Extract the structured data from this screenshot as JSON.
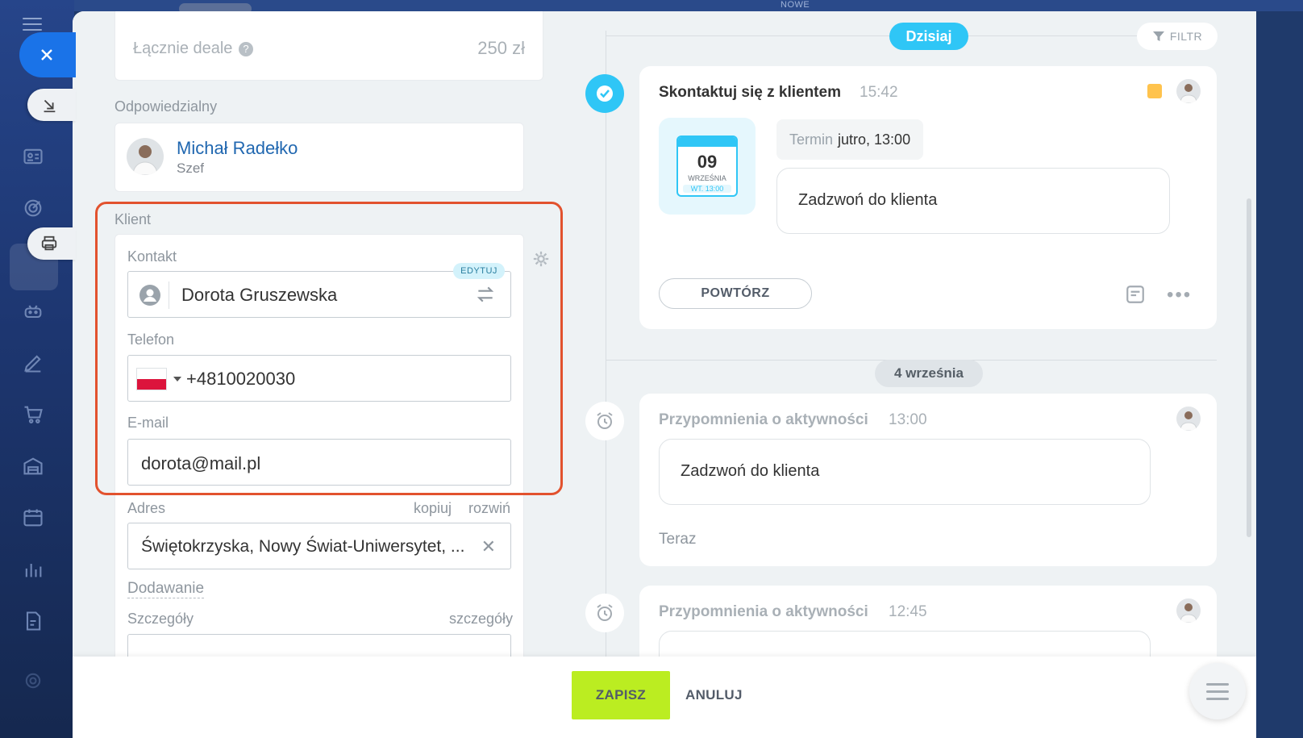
{
  "topbar": {
    "nowe_label": "NOWE"
  },
  "deals": {
    "label": "Łącznie deale",
    "value": "250 zł"
  },
  "responsible": {
    "section_label": "Odpowiedzialny",
    "name": "Michał Radełko",
    "role": "Szef"
  },
  "client": {
    "section_label": "Klient",
    "contact_label": "Kontakt",
    "edit_badge": "EDYTUJ",
    "contact_name": "Dorota Gruszewska",
    "phone_label": "Telefon",
    "phone_value": "+4810020030",
    "email_label": "E-mail",
    "email_value": "dorota@mail.pl"
  },
  "address": {
    "label": "Adres",
    "copy_link": "kopiuj",
    "expand_link": "rozwiń",
    "value": "Świętokrzyska, Nowy Świat-Uniwersytet, ..."
  },
  "adding_link": "Dodawanie",
  "details": {
    "label": "Szczegóły",
    "link": "szczegóły"
  },
  "timeline": {
    "today_badge": "Dzisiaj",
    "filter_label": "FILTR",
    "activity": {
      "title": "Skontaktuj się z klientem",
      "time": "15:42",
      "calendar_day": "09",
      "calendar_month": "WRZEŚNIA",
      "calendar_sub": "WT. 13:00",
      "deadline_label": "Termin",
      "deadline_value": "jutro, 13:00",
      "description": "Zadzwoń do klienta",
      "repeat_button": "POWTÓRZ"
    },
    "date_separator": "4 września",
    "reminders": [
      {
        "title": "Przypomnienia o aktywności",
        "time": "13:00",
        "text": "Zadzwoń do klienta",
        "footer": "Teraz"
      },
      {
        "title": "Przypomnienia o aktywności",
        "time": "12:45"
      }
    ]
  },
  "footer": {
    "save": "ZAPISZ",
    "cancel": "ANULUJ"
  },
  "colors": {
    "accent_blue": "#2fc6f6",
    "save_green": "#bbed21",
    "highlight_red": "#e2522e",
    "link_blue": "#2067b0",
    "status_yellow": "#ffc34d"
  }
}
